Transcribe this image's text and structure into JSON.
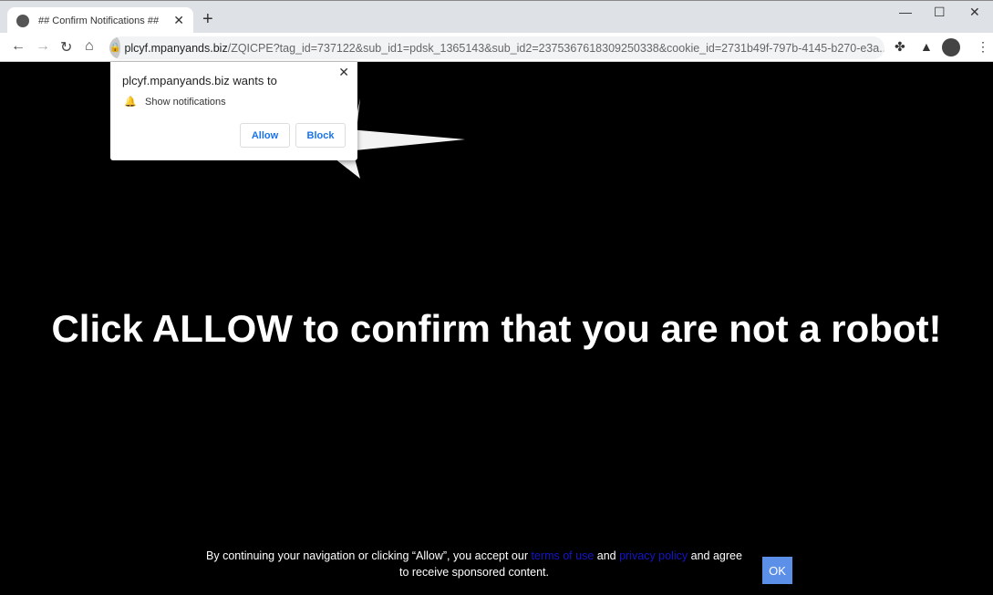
{
  "browser": {
    "tab_title": "## Confirm Notifications ##",
    "url_host": "plcyf.mpanyands.biz",
    "url_rest": "/ZQICPE?tag_id=737122&sub_id1=pdsk_1365143&sub_id2=2375367618309250338&cookie_id=2731b49f-797b-4145-b270-e3a..."
  },
  "popup": {
    "title": "plcyf.mpanyands.biz wants to",
    "permission": "Show notifications",
    "allow": "Allow",
    "block": "Block"
  },
  "page": {
    "headline": "Click ALLOW to confirm that you are not a robot!",
    "footer_1": "By continuing your navigation or clicking “Allow”, you accept our",
    "terms": "terms of use",
    "and": "and",
    "privacy": "privacy policy",
    "footer_2": "and agree to receive sponsored content.",
    "ok": "OK"
  },
  "colors": {
    "link": "#1515c8",
    "ok_button": "#5b8fe8"
  }
}
